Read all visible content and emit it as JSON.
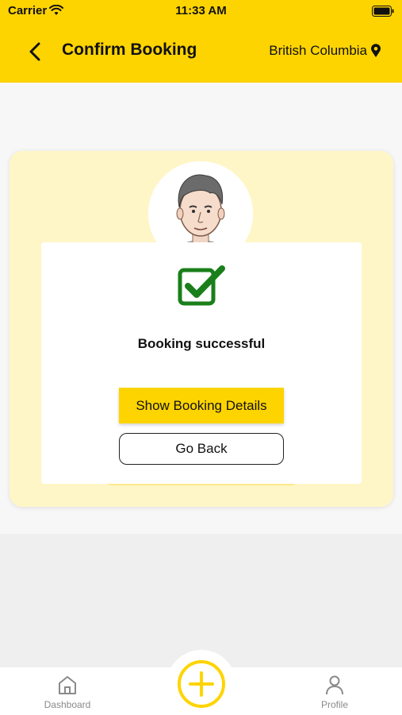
{
  "status_bar": {
    "carrier": "Carrier",
    "time": "11:33 AM",
    "wifi_icon": "wifi-icon",
    "battery_icon": "battery-icon"
  },
  "header": {
    "title": "Confirm Booking",
    "location": "British Columbia",
    "back_icon": "chevron-left-icon",
    "location_icon": "location-pin-icon",
    "background_color": "#fed400"
  },
  "confirmation": {
    "icon": "checkbox-checked-icon",
    "icon_color": "#1a7f1a",
    "message": "Booking successful",
    "primary_button": "Show Booking Details",
    "secondary_button": "Go Back",
    "card_color": "#fff6c8"
  },
  "tab_bar": {
    "tabs": [
      {
        "label": "Dashboard",
        "icon": "home-icon"
      },
      {
        "label": "Profile",
        "icon": "user-icon"
      }
    ],
    "center_action_icon": "plus-circle-icon",
    "accent_color": "#fed400"
  }
}
